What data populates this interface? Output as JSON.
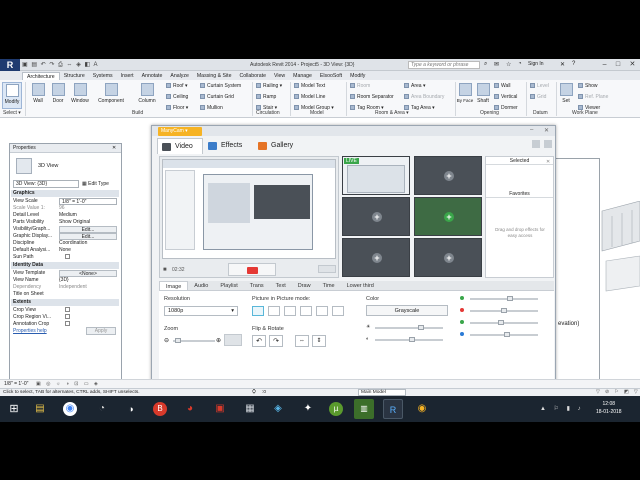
{
  "app": {
    "logo": "R",
    "title": "Autodesk Revit 2014 -   Project5 - 3D View: {3D}",
    "search_placeholder": "Type a keyword or phrase",
    "sign_in": "Sign In",
    "qat_icons": [
      "open-icon",
      "save-icon",
      "undo-icon",
      "redo-icon",
      "print-icon",
      "measure-icon",
      "3d-icon",
      "section-icon",
      "text-icon"
    ]
  },
  "ribbon": {
    "tabs": [
      "Architecture",
      "Structure",
      "Systems",
      "Insert",
      "Annotate",
      "Analyze",
      "Massing & Site",
      "Collaborate",
      "View",
      "Manage",
      "ElsooSoft",
      "Modify"
    ],
    "active_tab": "Architecture",
    "select_label": "Select ▾",
    "build_label": "Build",
    "circulation_label": "Circulation",
    "model_label": "Model",
    "room_area_label": "Room & Area ▾",
    "opening_label": "Opening",
    "datum_label": "Datum",
    "work_plane_label": "Work Plane",
    "big_buttons": {
      "modify": "Modify",
      "wall": "Wall",
      "door": "Door",
      "window": "Window",
      "component": "Component",
      "column": "Column"
    },
    "build_small": [
      "Roof ▾",
      "Ceiling",
      "Floor ▾",
      "Curtain System",
      "Curtain Grid",
      "Mullion"
    ],
    "circulation_small": [
      "Railing ▾",
      "Ramp",
      "Stair ▾"
    ],
    "model_small": [
      "Model Text",
      "Model Line",
      "Model Group ▾"
    ],
    "room_small": [
      "Room",
      "Room Separator",
      "Tag Room ▾",
      "Area ▾",
      "Area Boundary",
      "Tag Area ▾"
    ],
    "opening": {
      "by_face": "By Face",
      "shaft": "Shaft",
      "wall": "Wall",
      "vertical": "Vertical",
      "dormer": "Dormer"
    },
    "datum": {
      "level": "Level",
      "grid": "Grid"
    },
    "work_plane": {
      "set": "Set",
      "show": "Show",
      "ref_plane": "Ref. Plane",
      "viewer": "Viewer"
    }
  },
  "properties": {
    "header": "Properties",
    "type_name": "3D View",
    "selector": "3D View: {3D}",
    "edit_type": "Edit Type",
    "groups": {
      "graphics": "Graphics",
      "identity": "Identity Data",
      "extents": "Extents"
    },
    "rows_graphics": [
      [
        "View Scale",
        "1/8\" = 1'-0\""
      ],
      [
        "Scale Value  1:",
        "96"
      ],
      [
        "Detail Level",
        "Medium"
      ],
      [
        "Parts Visibility",
        "Show Original"
      ],
      [
        "Visibility/Graph...",
        "Edit..."
      ],
      [
        "Graphic Display...",
        "Edit..."
      ],
      [
        "Discipline",
        "Coordination"
      ],
      [
        "Default Analysi...",
        "None"
      ],
      [
        "Sun Path",
        ""
      ]
    ],
    "rows_identity": [
      [
        "View Template",
        "<None>"
      ],
      [
        "View Name",
        "{3D}"
      ],
      [
        "Dependency",
        "Independent"
      ],
      [
        "Title on Sheet",
        ""
      ]
    ],
    "rows_extents": [
      "Crop View",
      "Crop Region Vi...",
      "Annotation Crop"
    ],
    "help_link": "Properties help",
    "apply": "Apply"
  },
  "manycam": {
    "badge": "ManyCam ▾",
    "tabs": {
      "video": "Video",
      "effects": "Effects",
      "gallery": "Gallery"
    },
    "time": "02:32",
    "live": "LIVE",
    "selected": "Selected",
    "favorites": "Favorites",
    "drop_hint": "Drag and drop effects for easy access",
    "bottom_tabs": [
      "Image",
      "Audio",
      "Playlist",
      "Trans",
      "Text",
      "Draw",
      "Time",
      "Lower third"
    ],
    "active_bottom_tab": "Image",
    "resolution_label": "Resolution",
    "resolution_value": "1080p",
    "pip_label": "Picture in Picture mode:",
    "color_label": "Color",
    "grayscale": "Grayscale",
    "zoom_label": "Zoom",
    "flip_label": "Flip & Rotate",
    "accent": "#f6b324",
    "record_color": "#e53935",
    "color_dots": [
      "#3aa64a",
      "#e53935",
      "#3aa64a",
      "#2b7bd6"
    ],
    "sliders": [
      0.7,
      0.55,
      0.6,
      0.5,
      0.45,
      0.55
    ]
  },
  "canvas": {
    "elevation_text": "evation)"
  },
  "statusbar": {
    "hint": "Click to select, TAB for alternates, CTRL adds, SHIFT unselects.",
    "scale": "1/8\" = 1'-0\"",
    "model": "Main Model",
    "zero": ":0"
  },
  "taskbar": {
    "time": "12:08",
    "date": "18-01-2018"
  }
}
